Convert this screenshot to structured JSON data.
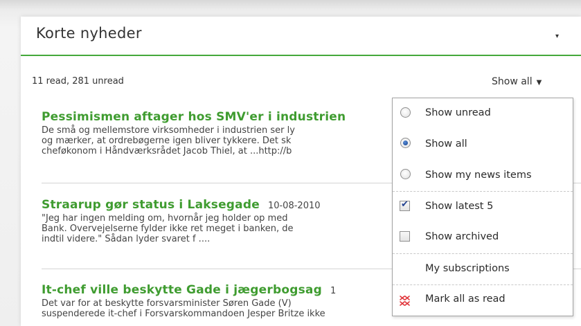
{
  "widget": {
    "title": "Korte nyheder",
    "header_caret": "▾"
  },
  "status": {
    "counts": "11 read, 281 unread",
    "filter_label": "Show all",
    "filter_caret": "▼"
  },
  "news_items": [
    {
      "title": "Pessimismen aftager hos SMV'er i industrien",
      "date": "",
      "lines": [
        "De små og mellemstore virksomheder i industrien ser ly",
        "og mærker, at ordrebøgerne igen bliver tykkere. Det sk",
        "cheføkonom i Håndværksrådet Jacob Thiel, at ...http://b"
      ]
    },
    {
      "title": "Straarup gør status i Laksegade",
      "date": "10-08-2010",
      "lines": [
        "\"Jeg har ingen melding om, hvornår jeg holder op med",
        "Bank. Overvejelserne fylder ikke ret meget i banken, de",
        "indtil videre.\" Sådan lyder svaret f ...."
      ]
    },
    {
      "title": "It-chef ville beskytte Gade i jægerbogsag",
      "date": "1",
      "lines": [
        "Det var for at beskytte forsvarsminister Søren Gade (V)",
        "suspenderede it-chef i Forsvarskommandoen Jesper Britze ikke"
      ]
    }
  ],
  "dropdown": {
    "options": [
      {
        "label": "Show unread",
        "control": "radio",
        "checked": false
      },
      {
        "label": "Show all",
        "control": "radio",
        "checked": true
      },
      {
        "label": "Show my news items",
        "control": "radio",
        "checked": false
      },
      {
        "label": "Show latest 5",
        "control": "checkbox",
        "checked": true
      },
      {
        "label": "Show archived",
        "control": "checkbox",
        "checked": false
      },
      {
        "label": "My subscriptions",
        "control": "none",
        "checked": false
      },
      {
        "label": "Mark all as read",
        "control": "mark-read-icon",
        "checked": false
      }
    ]
  },
  "colors": {
    "accent_green": "#3f9c30",
    "header_rule": "#44a83a",
    "mark_read_icon": "#e0353a"
  }
}
